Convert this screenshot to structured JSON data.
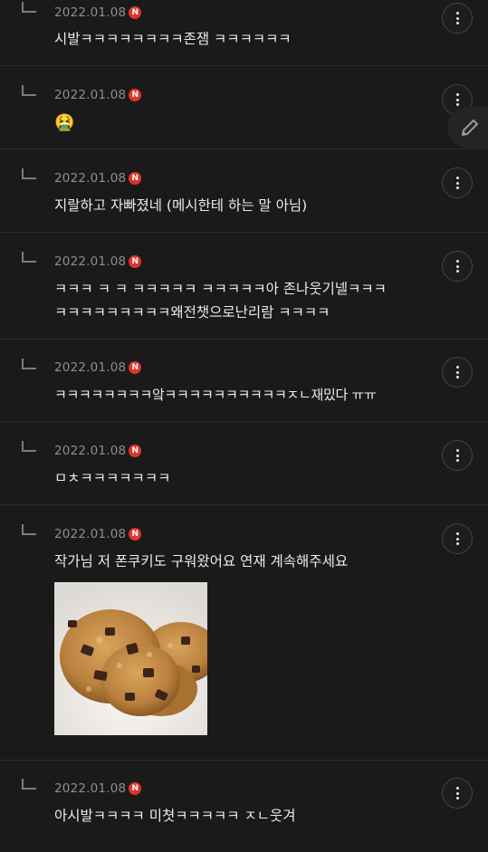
{
  "icons": {
    "reply": "reply-arrow-icon",
    "more": "more-vertical-icon",
    "new": "new-badge-icon",
    "edit": "pencil-icon"
  },
  "colors": {
    "background": "#1a1a1a",
    "badge": "#e0342c",
    "date": "#8e8e8e",
    "text": "#ebebeb"
  },
  "new_badge_label": "N",
  "comments": [
    {
      "date": "2022.01.08",
      "text": "시발ㅋㅋㅋㅋㅋㅋㅋㅋ존잼 ㅋㅋㅋㅋㅋㅋ"
    },
    {
      "date": "2022.01.08",
      "text": "🤮"
    },
    {
      "date": "2022.01.08",
      "text": "지랄하고 자빠졌네 (메시한테 하는 말 아님)"
    },
    {
      "date": "2022.01.08",
      "text": "ㅋㅋㅋ ㅋ ㅋ ㅋㅋㅋㅋㅋ ㅋㅋㅋㅋㅋ아 존나웃기넬ㅋㅋㅋ\nㅋㅋㅋㅋㅋㅋㅋㅋㅋ왜전챗으로난리람 ㅋㅋㅋㅋ"
    },
    {
      "date": "2022.01.08",
      "text": "ㅋㅋㅋㅋㅋㅋㅋㅋ앜ㅋㅋㅋㅋㅋㅋㅋㅋㅋㅋㅈㄴ재밌다 ㅠㅠ"
    },
    {
      "date": "2022.01.08",
      "text": "ㅁㅊㅋㅋㅋㅋㅋㅋㅋ"
    },
    {
      "date": "2022.01.08",
      "text": "작가님 저 폰쿠키도 구워왔어요 연재 계속해주세요"
    },
    {
      "date": "2022.01.08",
      "text": "아시발ㅋㅋㅋㅋ 미쳣ㅋㅋㅋㅋㅋ ㅈㄴ웃겨"
    }
  ]
}
